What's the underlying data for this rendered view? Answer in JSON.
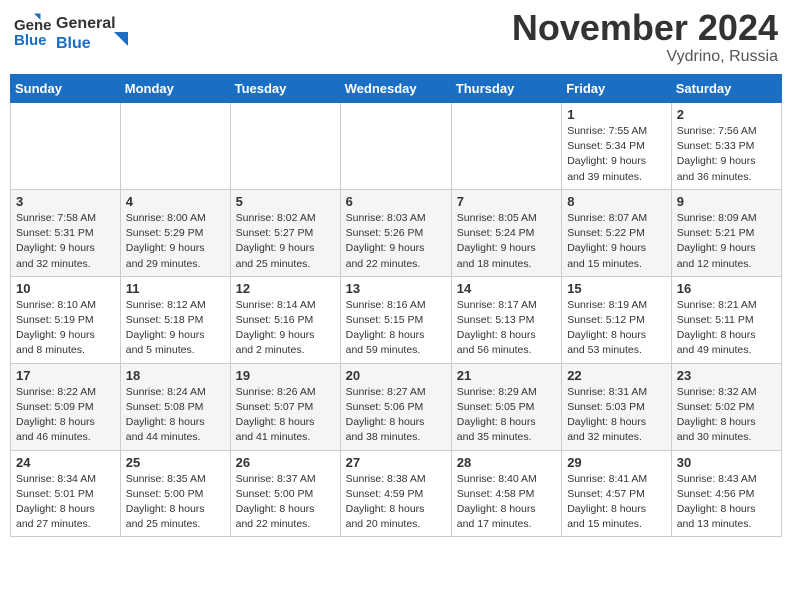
{
  "header": {
    "logo_general": "General",
    "logo_blue": "Blue",
    "month_title": "November 2024",
    "location": "Vydrino, Russia"
  },
  "weekdays": [
    "Sunday",
    "Monday",
    "Tuesday",
    "Wednesday",
    "Thursday",
    "Friday",
    "Saturday"
  ],
  "weeks": [
    [
      {
        "day": "",
        "info": ""
      },
      {
        "day": "",
        "info": ""
      },
      {
        "day": "",
        "info": ""
      },
      {
        "day": "",
        "info": ""
      },
      {
        "day": "",
        "info": ""
      },
      {
        "day": "1",
        "info": "Sunrise: 7:55 AM\nSunset: 5:34 PM\nDaylight: 9 hours\nand 39 minutes."
      },
      {
        "day": "2",
        "info": "Sunrise: 7:56 AM\nSunset: 5:33 PM\nDaylight: 9 hours\nand 36 minutes."
      }
    ],
    [
      {
        "day": "3",
        "info": "Sunrise: 7:58 AM\nSunset: 5:31 PM\nDaylight: 9 hours\nand 32 minutes."
      },
      {
        "day": "4",
        "info": "Sunrise: 8:00 AM\nSunset: 5:29 PM\nDaylight: 9 hours\nand 29 minutes."
      },
      {
        "day": "5",
        "info": "Sunrise: 8:02 AM\nSunset: 5:27 PM\nDaylight: 9 hours\nand 25 minutes."
      },
      {
        "day": "6",
        "info": "Sunrise: 8:03 AM\nSunset: 5:26 PM\nDaylight: 9 hours\nand 22 minutes."
      },
      {
        "day": "7",
        "info": "Sunrise: 8:05 AM\nSunset: 5:24 PM\nDaylight: 9 hours\nand 18 minutes."
      },
      {
        "day": "8",
        "info": "Sunrise: 8:07 AM\nSunset: 5:22 PM\nDaylight: 9 hours\nand 15 minutes."
      },
      {
        "day": "9",
        "info": "Sunrise: 8:09 AM\nSunset: 5:21 PM\nDaylight: 9 hours\nand 12 minutes."
      }
    ],
    [
      {
        "day": "10",
        "info": "Sunrise: 8:10 AM\nSunset: 5:19 PM\nDaylight: 9 hours\nand 8 minutes."
      },
      {
        "day": "11",
        "info": "Sunrise: 8:12 AM\nSunset: 5:18 PM\nDaylight: 9 hours\nand 5 minutes."
      },
      {
        "day": "12",
        "info": "Sunrise: 8:14 AM\nSunset: 5:16 PM\nDaylight: 9 hours\nand 2 minutes."
      },
      {
        "day": "13",
        "info": "Sunrise: 8:16 AM\nSunset: 5:15 PM\nDaylight: 8 hours\nand 59 minutes."
      },
      {
        "day": "14",
        "info": "Sunrise: 8:17 AM\nSunset: 5:13 PM\nDaylight: 8 hours\nand 56 minutes."
      },
      {
        "day": "15",
        "info": "Sunrise: 8:19 AM\nSunset: 5:12 PM\nDaylight: 8 hours\nand 53 minutes."
      },
      {
        "day": "16",
        "info": "Sunrise: 8:21 AM\nSunset: 5:11 PM\nDaylight: 8 hours\nand 49 minutes."
      }
    ],
    [
      {
        "day": "17",
        "info": "Sunrise: 8:22 AM\nSunset: 5:09 PM\nDaylight: 8 hours\nand 46 minutes."
      },
      {
        "day": "18",
        "info": "Sunrise: 8:24 AM\nSunset: 5:08 PM\nDaylight: 8 hours\nand 44 minutes."
      },
      {
        "day": "19",
        "info": "Sunrise: 8:26 AM\nSunset: 5:07 PM\nDaylight: 8 hours\nand 41 minutes."
      },
      {
        "day": "20",
        "info": "Sunrise: 8:27 AM\nSunset: 5:06 PM\nDaylight: 8 hours\nand 38 minutes."
      },
      {
        "day": "21",
        "info": "Sunrise: 8:29 AM\nSunset: 5:05 PM\nDaylight: 8 hours\nand 35 minutes."
      },
      {
        "day": "22",
        "info": "Sunrise: 8:31 AM\nSunset: 5:03 PM\nDaylight: 8 hours\nand 32 minutes."
      },
      {
        "day": "23",
        "info": "Sunrise: 8:32 AM\nSunset: 5:02 PM\nDaylight: 8 hours\nand 30 minutes."
      }
    ],
    [
      {
        "day": "24",
        "info": "Sunrise: 8:34 AM\nSunset: 5:01 PM\nDaylight: 8 hours\nand 27 minutes."
      },
      {
        "day": "25",
        "info": "Sunrise: 8:35 AM\nSunset: 5:00 PM\nDaylight: 8 hours\nand 25 minutes."
      },
      {
        "day": "26",
        "info": "Sunrise: 8:37 AM\nSunset: 5:00 PM\nDaylight: 8 hours\nand 22 minutes."
      },
      {
        "day": "27",
        "info": "Sunrise: 8:38 AM\nSunset: 4:59 PM\nDaylight: 8 hours\nand 20 minutes."
      },
      {
        "day": "28",
        "info": "Sunrise: 8:40 AM\nSunset: 4:58 PM\nDaylight: 8 hours\nand 17 minutes."
      },
      {
        "day": "29",
        "info": "Sunrise: 8:41 AM\nSunset: 4:57 PM\nDaylight: 8 hours\nand 15 minutes."
      },
      {
        "day": "30",
        "info": "Sunrise: 8:43 AM\nSunset: 4:56 PM\nDaylight: 8 hours\nand 13 minutes."
      }
    ]
  ]
}
